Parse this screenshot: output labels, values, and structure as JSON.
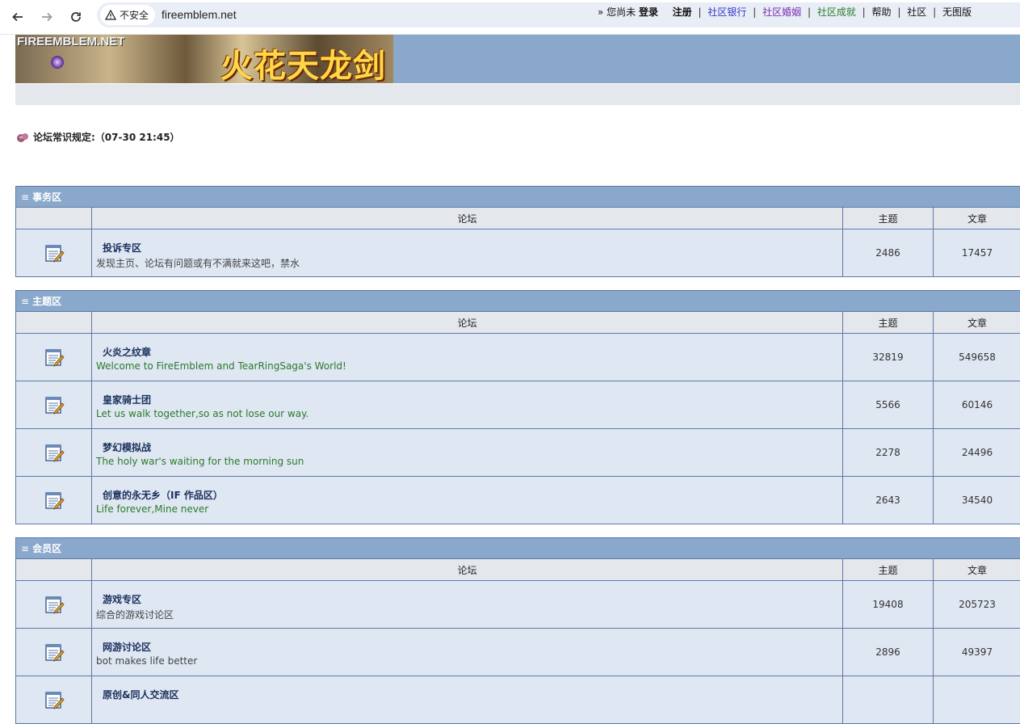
{
  "browser": {
    "security_label": "不安全",
    "url": "fireemblem.net"
  },
  "banner": {
    "logo_net": "FIREEMBLEM.NET",
    "logo_title": "火花天龙剑"
  },
  "topnav": {
    "prefix": "» 您尚未",
    "login": "登录",
    "register": "注册",
    "bank": "社区银行",
    "marriage": "社区婚姻",
    "achievements": "社区成就",
    "help": "帮助",
    "community": "社区",
    "no_image": "无图版"
  },
  "notice": {
    "text": "论坛常识规定:（07-30 21:45）"
  },
  "sections": [
    {
      "title": "事务区",
      "col_forum": "论坛",
      "col_topics": "主题",
      "col_posts": "文章",
      "forums": [
        {
          "title": "投诉专区",
          "desc": "发现主页、论坛有问题或有不满就来这吧，禁水",
          "topics": "2486",
          "posts": "17457"
        }
      ]
    },
    {
      "title": "主题区",
      "col_forum": "论坛",
      "col_topics": "主题",
      "col_posts": "文章",
      "forums": [
        {
          "title": "火炎之纹章",
          "desc": "Welcome to FireEmblem and TearRingSaga's World!",
          "topics": "32819",
          "posts": "549658"
        },
        {
          "title": "皇家骑士团",
          "desc": "Let us walk together,so as not lose our way.",
          "topics": "5566",
          "posts": "60146"
        },
        {
          "title": "梦幻模拟战",
          "desc": "The holy war's waiting for the morning sun",
          "topics": "2278",
          "posts": "24496"
        },
        {
          "title": "创意的永无乡（IF 作品区）",
          "desc": "Life forever,Mine never",
          "topics": "2643",
          "posts": "34540"
        }
      ]
    },
    {
      "title": "会员区",
      "col_forum": "论坛",
      "col_topics": "主题",
      "col_posts": "文章",
      "forums": [
        {
          "title": "游戏专区",
          "desc": "综合的游戏讨论区",
          "topics": "19408",
          "posts": "205723"
        },
        {
          "title": "网游讨论区",
          "desc": "bot makes life better",
          "topics": "2896",
          "posts": "49397"
        },
        {
          "title": "原创&同人交流区",
          "desc": "",
          "topics": "",
          "posts": ""
        }
      ]
    }
  ]
}
